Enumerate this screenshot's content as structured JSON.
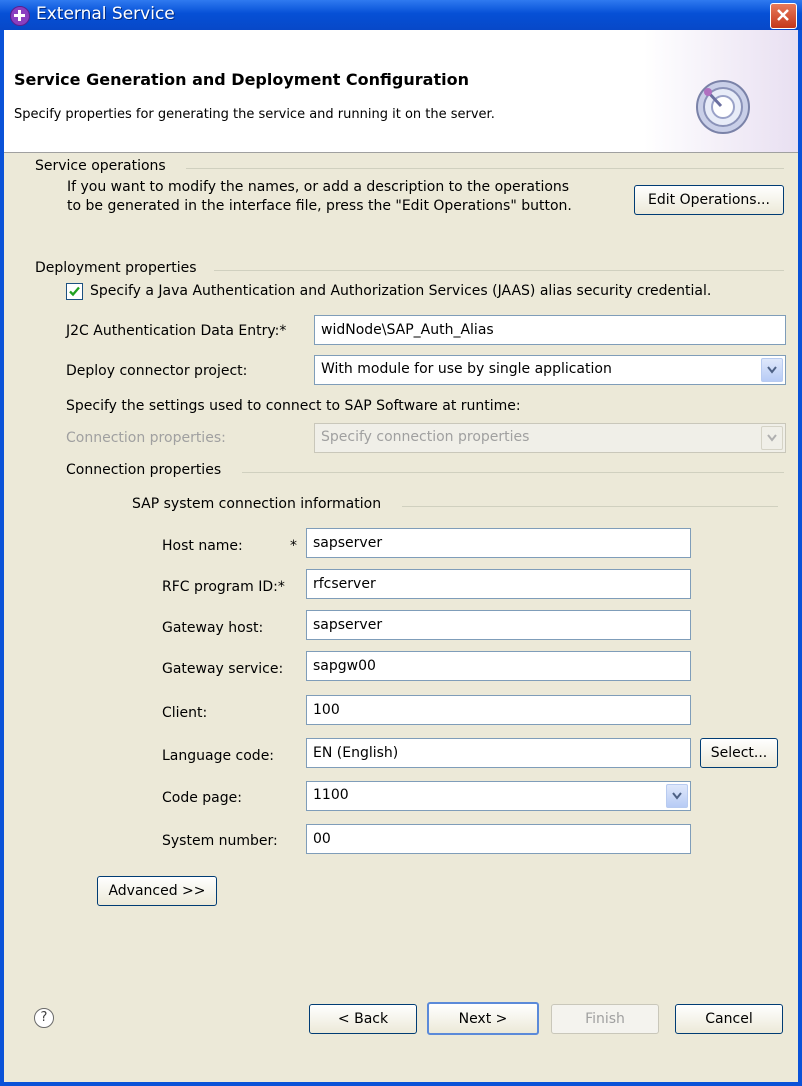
{
  "window": {
    "title": "External Service"
  },
  "banner": {
    "title": "Service Generation and Deployment Configuration",
    "description": "Specify properties for generating the service and running it on the server."
  },
  "service_operations": {
    "group_label": "Service operations",
    "instruction_line1": "If you want to modify the names, or add a description to the operations",
    "instruction_line2": "to be generated in the interface file, press the \"Edit Operations\" button.",
    "edit_button": "Edit Operations..."
  },
  "deployment": {
    "group_label": "Deployment properties",
    "jaas_checkbox_label": "Specify a Java Authentication and Authorization Services (JAAS) alias security credential.",
    "jaas_checked": true,
    "j2c_label": "J2C Authentication Data Entry:",
    "j2c_value": "widNode\\SAP_Auth_Alias",
    "deploy_label": "Deploy connector project:",
    "deploy_value": "With module for use by single application",
    "runtime_note": "Specify the settings used to connect to SAP Software at runtime:",
    "conn_props_label": "Connection properties:",
    "conn_props_value": "Specify connection properties"
  },
  "connection": {
    "group_label": "Connection properties",
    "sap_group_label": "SAP system connection information",
    "required_marker": "*",
    "host_label": "Host name:",
    "host_value": "sapserver",
    "rfc_label": "RFC program ID:",
    "rfc_value": "rfcserver",
    "gateway_host_label": "Gateway host:",
    "gateway_host_value": "sapserver",
    "gateway_service_label": "Gateway service:",
    "gateway_service_value": "sapgw00",
    "client_label": "Client:",
    "client_value": "100",
    "language_label": "Language code:",
    "language_value": "EN (English)",
    "select_button": "Select...",
    "code_page_label": "Code page:",
    "code_page_value": "1100",
    "system_number_label": "System number:",
    "system_number_value": "00",
    "advanced_button": "Advanced >>"
  },
  "footer": {
    "help_glyph": "?",
    "back": "< Back",
    "next": "Next >",
    "finish": "Finish",
    "cancel": "Cancel"
  }
}
